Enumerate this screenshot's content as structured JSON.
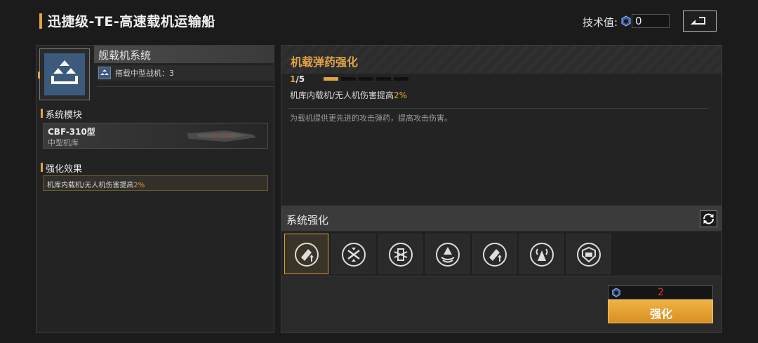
{
  "header": {
    "title": "迅捷级-TE-高速载机运输船",
    "tech_label": "技术值:",
    "tech_value": "0"
  },
  "system": {
    "name": "舰载机系统",
    "sub_label": "搭载中型战机：3"
  },
  "module_section": {
    "title": "系统模块",
    "module_name": "CBF-310型",
    "module_type": "中型机库"
  },
  "effect_section": {
    "title": "强化效果",
    "effect_prefix": "机库内载机/无人机伤害提高",
    "effect_value": "2%"
  },
  "detail": {
    "title": "机载弹药强化",
    "level_current": "1",
    "level_max": "/5",
    "level_progress": 0.2,
    "effect_prefix": "机库内载机/无人机伤害提高",
    "effect_value": "2%",
    "description": "为载机提供更先进的攻击弹药，提高攻击伤害。"
  },
  "enhance": {
    "title": "系统强化",
    "slots": [
      {
        "icon": "missile-upgrade-icon",
        "active": true
      },
      {
        "icon": "drone-swap-icon",
        "active": false
      },
      {
        "icon": "engine-swap-icon",
        "active": false
      },
      {
        "icon": "fighter-cone-icon",
        "active": false
      },
      {
        "icon": "missile-upgrade-icon",
        "active": false
      },
      {
        "icon": "signal-tower-icon",
        "active": false
      },
      {
        "icon": "repair-shield-icon",
        "active": false
      }
    ],
    "cost": "2",
    "button_label": "强化"
  },
  "colors": {
    "accent": "#e0a245",
    "cost_insufficient": "#e03a2a"
  }
}
